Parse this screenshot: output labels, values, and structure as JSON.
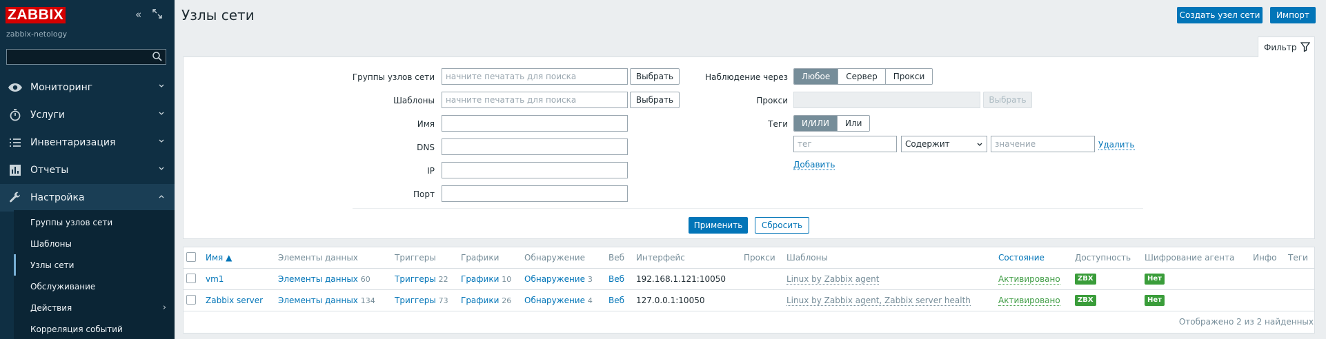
{
  "sidebar": {
    "logo": "ZABBIX",
    "server_name": "zabbix-netology",
    "search_placeholder": "",
    "menu": [
      {
        "label": "Мониторинг",
        "icon": "eye-icon"
      },
      {
        "label": "Услуги",
        "icon": "clock-icon"
      },
      {
        "label": "Инвентаризация",
        "icon": "list-icon"
      },
      {
        "label": "Отчеты",
        "icon": "bar-chart-icon"
      },
      {
        "label": "Настройка",
        "icon": "wrench-icon"
      }
    ],
    "submenu": [
      {
        "label": "Группы узлов сети"
      },
      {
        "label": "Шаблоны"
      },
      {
        "label": "Узлы сети"
      },
      {
        "label": "Обслуживание"
      },
      {
        "label": "Действия"
      },
      {
        "label": "Корреляция событий"
      }
    ]
  },
  "header": {
    "title": "Узлы сети",
    "create_button": "Создать узел сети",
    "import_button": "Импорт"
  },
  "filter": {
    "tab_label": "Фильтр",
    "host_groups_label": "Группы узлов сети",
    "host_groups_placeholder": "начните печатать для поиска",
    "templates_label": "Шаблоны",
    "templates_placeholder": "начните печатать для поиска",
    "select_button": "Выбрать",
    "name_label": "Имя",
    "dns_label": "DNS",
    "ip_label": "IP",
    "port_label": "Порт",
    "monitored_by_label": "Наблюдение через",
    "monitored_by_options": [
      "Любое",
      "Сервер",
      "Прокси"
    ],
    "monitored_by_selected": "Любое",
    "proxy_label": "Прокси",
    "tags_label": "Теги",
    "tags_options": [
      "И/ИЛИ",
      "Или"
    ],
    "tags_selected": "И/ИЛИ",
    "tag_placeholder": "тег",
    "tag_operator": "Содержит",
    "value_placeholder": "значение",
    "remove_link": "Удалить",
    "add_link": "Добавить",
    "apply_button": "Применить",
    "reset_button": "Сбросить"
  },
  "table": {
    "columns": [
      "Имя ▲",
      "Элементы данных",
      "Триггеры",
      "Графики",
      "Обнаружение",
      "Веб",
      "Интерфейс",
      "Прокси",
      "Шаблоны",
      "Состояние",
      "Доступность",
      "Шифрование агента",
      "Инфо",
      "Теги"
    ],
    "rows": [
      {
        "name": "vm1",
        "items": "Элементы данных",
        "items_count": "60",
        "triggers": "Триггеры",
        "triggers_count": "22",
        "graphs": "Графики",
        "graphs_count": "10",
        "discovery": "Обнаружение",
        "discovery_count": "3",
        "web": "Веб",
        "interface": "192.168.1.121:10050",
        "templates": "Linux by Zabbix agent",
        "status": "Активировано",
        "availability": "ZBX",
        "encryption": "Нет"
      },
      {
        "name": "Zabbix server",
        "items": "Элементы данных",
        "items_count": "134",
        "triggers": "Триггеры",
        "triggers_count": "73",
        "graphs": "Графики",
        "graphs_count": "26",
        "discovery": "Обнаружение",
        "discovery_count": "4",
        "web": "Веб",
        "interface": "127.0.0.1:10050",
        "templates": "Linux by Zabbix agent, Zabbix server health",
        "status": "Активировано",
        "availability": "ZBX",
        "encryption": "Нет"
      }
    ],
    "footer": "Отображено 2 из 2 найденных"
  },
  "colors": {
    "sidebar_bg": "#0f2f43",
    "accent": "#0275b8",
    "enabled_green": "#429e47",
    "badge_green": "#3a9d3a",
    "logo_red": "#d40000"
  }
}
